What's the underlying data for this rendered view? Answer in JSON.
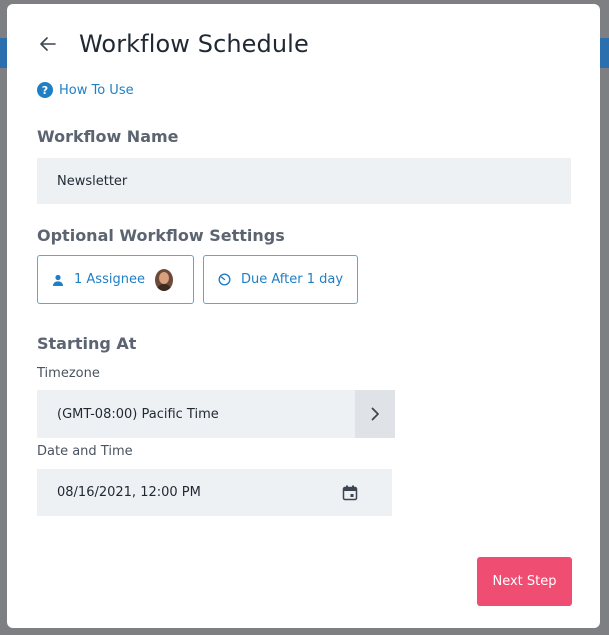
{
  "header": {
    "title": "Workflow Schedule"
  },
  "how_to_use": "How To Use",
  "workflow_name": {
    "label": "Workflow Name",
    "value": "Newsletter"
  },
  "optional_settings": {
    "label": "Optional Workflow Settings",
    "assignee_chip": "1 Assignee",
    "due_chip": "Due After 1 day"
  },
  "starting_at": {
    "label": "Starting At",
    "timezone_label": "Timezone",
    "timezone_value": "(GMT-08:00) Pacific Time",
    "datetime_label": "Date and Time",
    "datetime_value": "08/16/2021, 12:00 PM"
  },
  "next_button": "Next Step",
  "colors": {
    "accent_blue": "#1f7fc4",
    "primary_pink": "#ef4d72",
    "input_bg": "#eef1f4"
  }
}
